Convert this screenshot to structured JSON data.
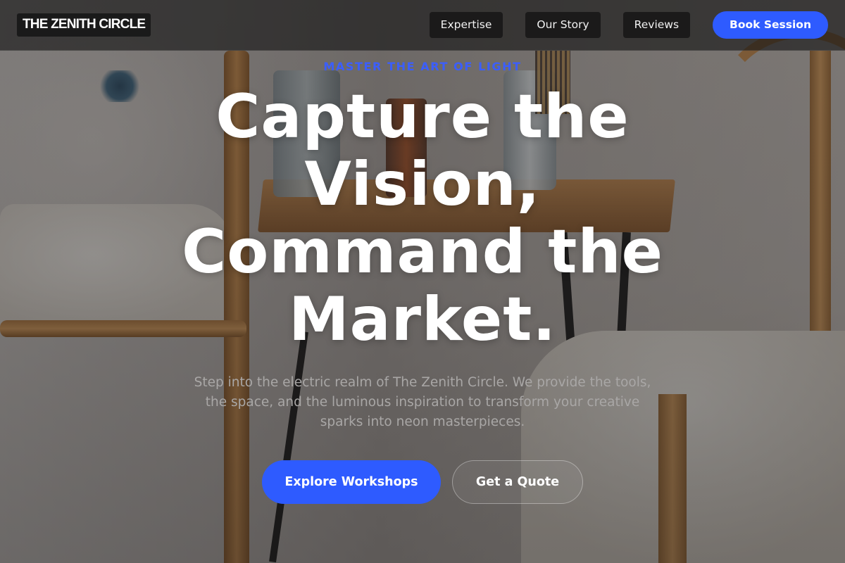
{
  "header": {
    "logo": "THE ZENITH CIRCLE",
    "nav": [
      {
        "label": "Expertise"
      },
      {
        "label": "Our Story"
      },
      {
        "label": "Reviews"
      }
    ],
    "cta_label": "Book Session"
  },
  "hero": {
    "eyebrow": "MASTER THE ART OF LIGHT",
    "headline_lines": [
      "Capture the",
      "Vision,",
      "Command the",
      "Market."
    ],
    "subhead": "Step into the electric realm of The Zenith Circle. We provide the tools, the space, and the luminous inspiration to transform your creative sparks into neon masterpieces.",
    "primary_cta": "Explore Workshops",
    "secondary_cta": "Get a Quote",
    "background_image": "art-studio-photo"
  },
  "colors": {
    "accent": "#2e5bff",
    "eyebrow": "#3b5eff",
    "header_bg": "#141313",
    "subhead_text": "#a9a7a6"
  }
}
